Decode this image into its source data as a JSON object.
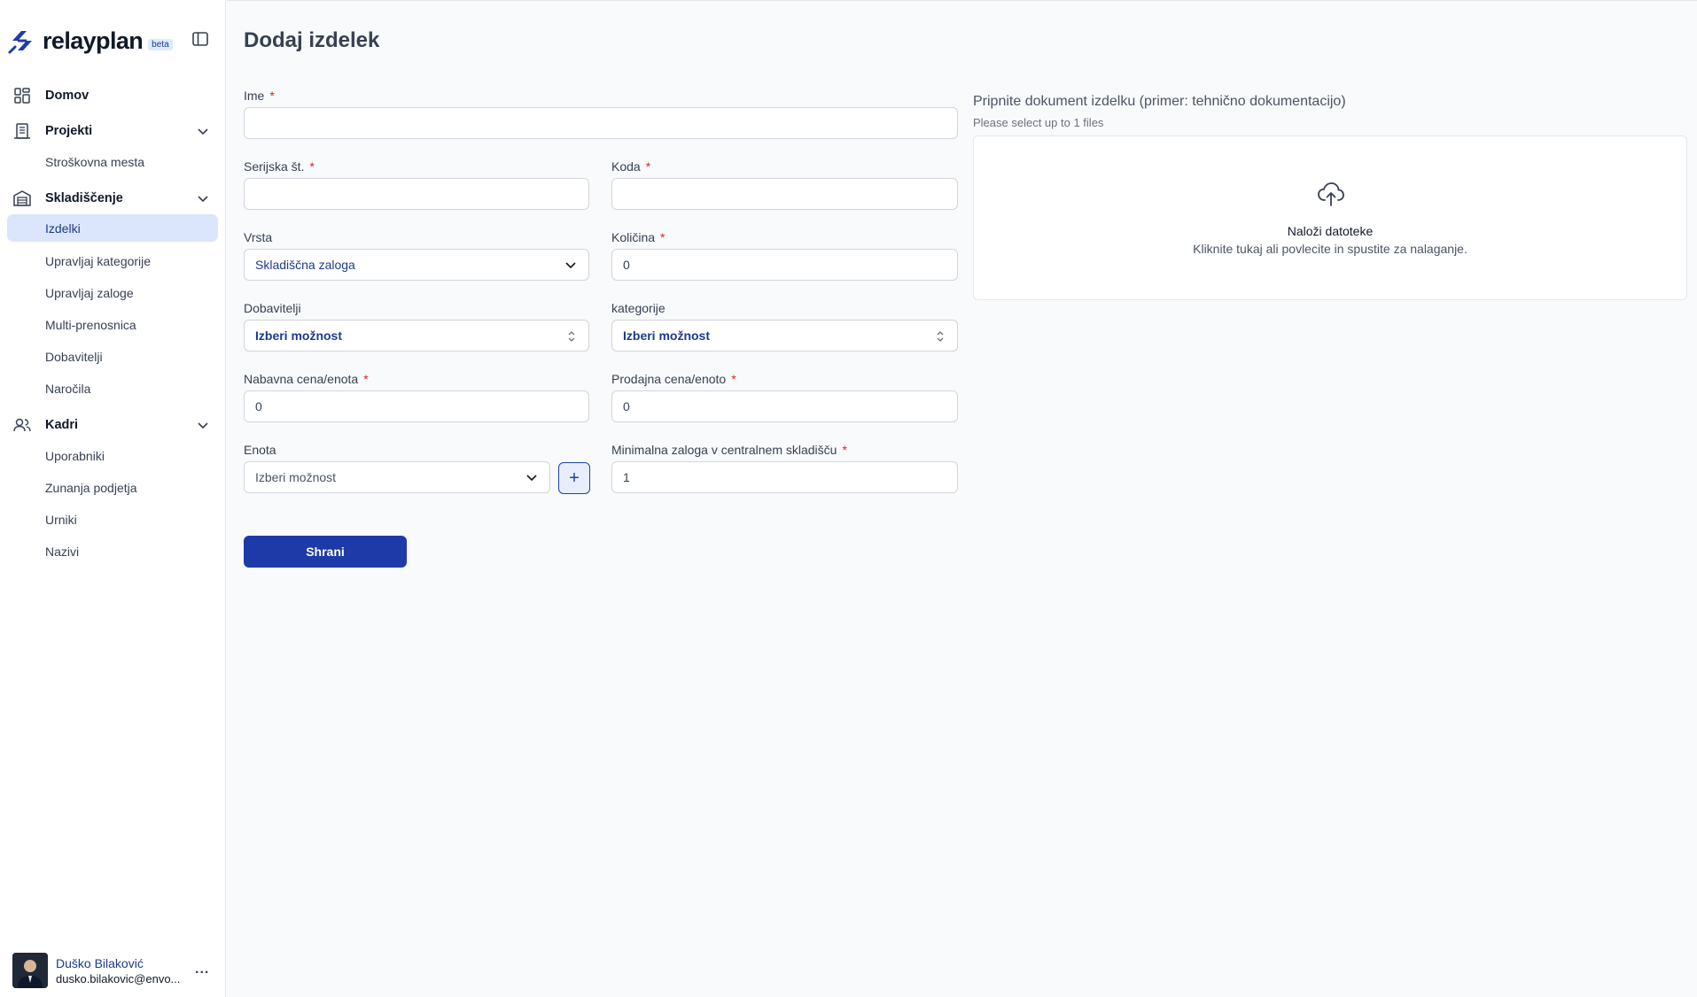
{
  "brand": {
    "name": "relayplan",
    "badge": "beta"
  },
  "sidebar": {
    "sections": [
      {
        "label": "Domov"
      },
      {
        "label": "Projekti",
        "items": [
          "Stroškovna mesta"
        ]
      },
      {
        "label": "Skladiščenje",
        "items": [
          "Izdelki",
          "Upravljaj kategorije",
          "Upravljaj zaloge",
          "Multi-prenosnica",
          "Dobavitelji",
          "Naročila"
        ],
        "active_item": "Izdelki"
      },
      {
        "label": "Kadri",
        "items": [
          "Uporabniki",
          "Zunanja podjetja",
          "Urniki",
          "Nazivi"
        ]
      }
    ]
  },
  "user": {
    "name": "Duško Bilaković",
    "email": "dusko.bilakovic@envo...",
    "more": "..."
  },
  "page": {
    "title": "Dodaj izdelek"
  },
  "form": {
    "required_mark": "*",
    "ime": {
      "label": "Ime",
      "value": ""
    },
    "serijska": {
      "label": "Serijska št.",
      "value": ""
    },
    "koda": {
      "label": "Koda",
      "value": ""
    },
    "vrsta": {
      "label": "Vrsta",
      "value": "Skladiščna zaloga"
    },
    "kolicina": {
      "label": "Količina",
      "value": "0"
    },
    "dobavitelji": {
      "label": "Dobavitelji",
      "value": "Izberi možnost"
    },
    "kategorije": {
      "label": "kategorije",
      "value": "Izberi možnost"
    },
    "nabavna": {
      "label": "Nabavna cena/enota",
      "value": "0"
    },
    "prodajna": {
      "label": "Prodajna cena/enoto",
      "value": "0"
    },
    "enota": {
      "label": "Enota",
      "value": "Izberi možnost"
    },
    "minimalna": {
      "label": "Minimalna zaloga v centralnem skladišču",
      "value": "1"
    },
    "add_unit_symbol": "+",
    "save_label": "Shrani"
  },
  "attachment": {
    "label": "Pripnite dokument izdelku (primer: tehnično dokumentacijo)",
    "hint": "Please select up to 1 files",
    "dropzone_title": "Naloži datoteke",
    "dropzone_subtitle": "Kliknite tukaj ali povlecite in spustite za nalaganje."
  },
  "colors": {
    "accent": "#1e3aa8",
    "active_bg": "#dbe5fb",
    "required": "#dc2626"
  }
}
